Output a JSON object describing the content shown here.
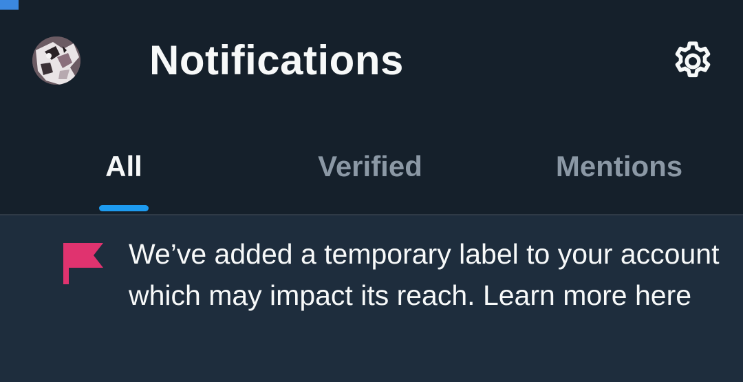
{
  "header": {
    "title": "Notifications",
    "avatar_icon": "user-avatar",
    "settings_icon": "gear-icon"
  },
  "tabs": [
    {
      "label": "All",
      "active": true
    },
    {
      "label": "Verified",
      "active": false
    },
    {
      "label": "Mentions",
      "active": false
    }
  ],
  "notice": {
    "icon": "flag-icon",
    "text": "We’ve added a temporary label to your account which may impact its reach. Learn more here"
  },
  "colors": {
    "background": "#15202b",
    "notice_background": "#1e2d3d",
    "accent": "#1d9bf0",
    "flag": "#e0336f",
    "text_primary": "#f7f9f9",
    "text_secondary": "#8b98a5"
  }
}
